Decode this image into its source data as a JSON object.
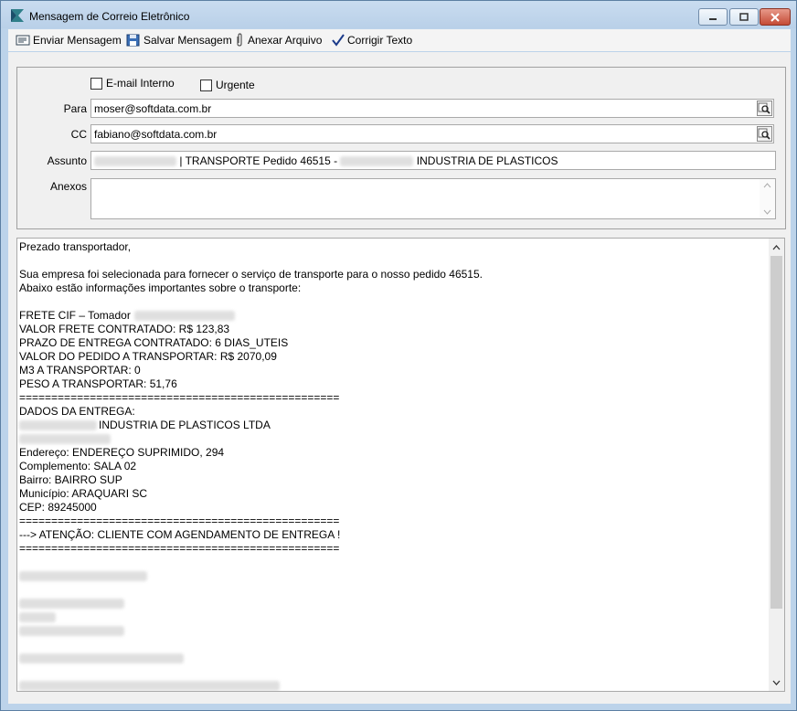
{
  "window": {
    "title": "Mensagem de Correio Eletrônico"
  },
  "toolbar": {
    "send_label": "Enviar Mensagem",
    "save_label": "Salvar Mensagem",
    "attach_label": "Anexar Arquivo",
    "spell_label": "Corrigir Texto"
  },
  "form": {
    "internal_email_label": "E-mail Interno",
    "urgent_label": "Urgente",
    "to_label": "Para",
    "to_value": "moser@softdata.com.br",
    "cc_label": "CC",
    "cc_value": "fabiano@softdata.com.br",
    "subject_label": "Assunto",
    "subject_part1": "| TRANSPORTE Pedido 46515 -",
    "subject_part2": "INDUSTRIA DE PLASTICOS",
    "attachments_label": "Anexos"
  },
  "body": {
    "lines": [
      "Prezado transportador,",
      "",
      "Sua empresa foi selecionada para fornecer o serviço de transporte para o nosso pedido 46515.",
      "Abaixo estão informações importantes sobre o transporte:",
      "",
      "FRETE CIF – Tomador",
      "VALOR FRETE CONTRATADO: R$ 123,83",
      "PRAZO DE ENTREGA CONTRATADO: 6 DIAS_UTEIS",
      "VALOR DO PEDIDO A TRANSPORTAR: R$ 2070,09",
      "M3 A TRANSPORTAR: 0",
      "PESO A TRANSPORTAR: 51,76",
      "==================================================",
      "DADOS DA ENTREGA:",
      "INDUSTRIA DE PLASTICOS LTDA",
      "",
      "Endereço: ENDEREÇO SUPRIMIDO, 294",
      "Complemento: SALA 02",
      "Bairro: BAIRRO SUP",
      "Município: ARAQUARI SC",
      "CEP: 89245000",
      "==================================================",
      "---> ATENÇÃO: CLIENTE COM AGENDAMENTO DE ENTREGA !",
      "=================================================="
    ]
  }
}
